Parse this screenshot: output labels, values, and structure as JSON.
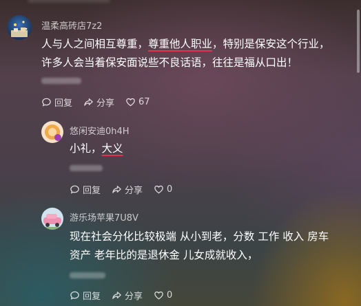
{
  "comments": [
    {
      "username": "温柔高砖店7z2",
      "lines": [
        [
          "人与人之间相互尊重，",
          "尊重他人职业",
          "，特别是保安这个行业，"
        ],
        [
          "许多人会当着保安面说些不良话语，往往是福从口出！"
        ]
      ],
      "actions": {
        "reply": "回复",
        "share": "分享",
        "likes": "67"
      }
    },
    {
      "username": "悠闲安迪0h4H",
      "lines": [
        [
          "小礼，",
          "大义",
          ""
        ]
      ],
      "actions": {
        "reply": "回复",
        "share": "分享",
        "likes": "0"
      }
    },
    {
      "username": "游乐场苹果7U8V",
      "lines": [
        [
          "现在社会分化比较极端 从小到老，分数 工作 收入 房车"
        ],
        [
          "资产 老年比的是退休金 儿女成就收入，"
        ]
      ],
      "actions": {
        "reply": "回复",
        "share": "分享",
        "likes": "0"
      }
    }
  ],
  "colors": {
    "highlight_underline": "#e0334d"
  },
  "icons": [
    "reply-icon",
    "share-icon",
    "heart-icon"
  ]
}
